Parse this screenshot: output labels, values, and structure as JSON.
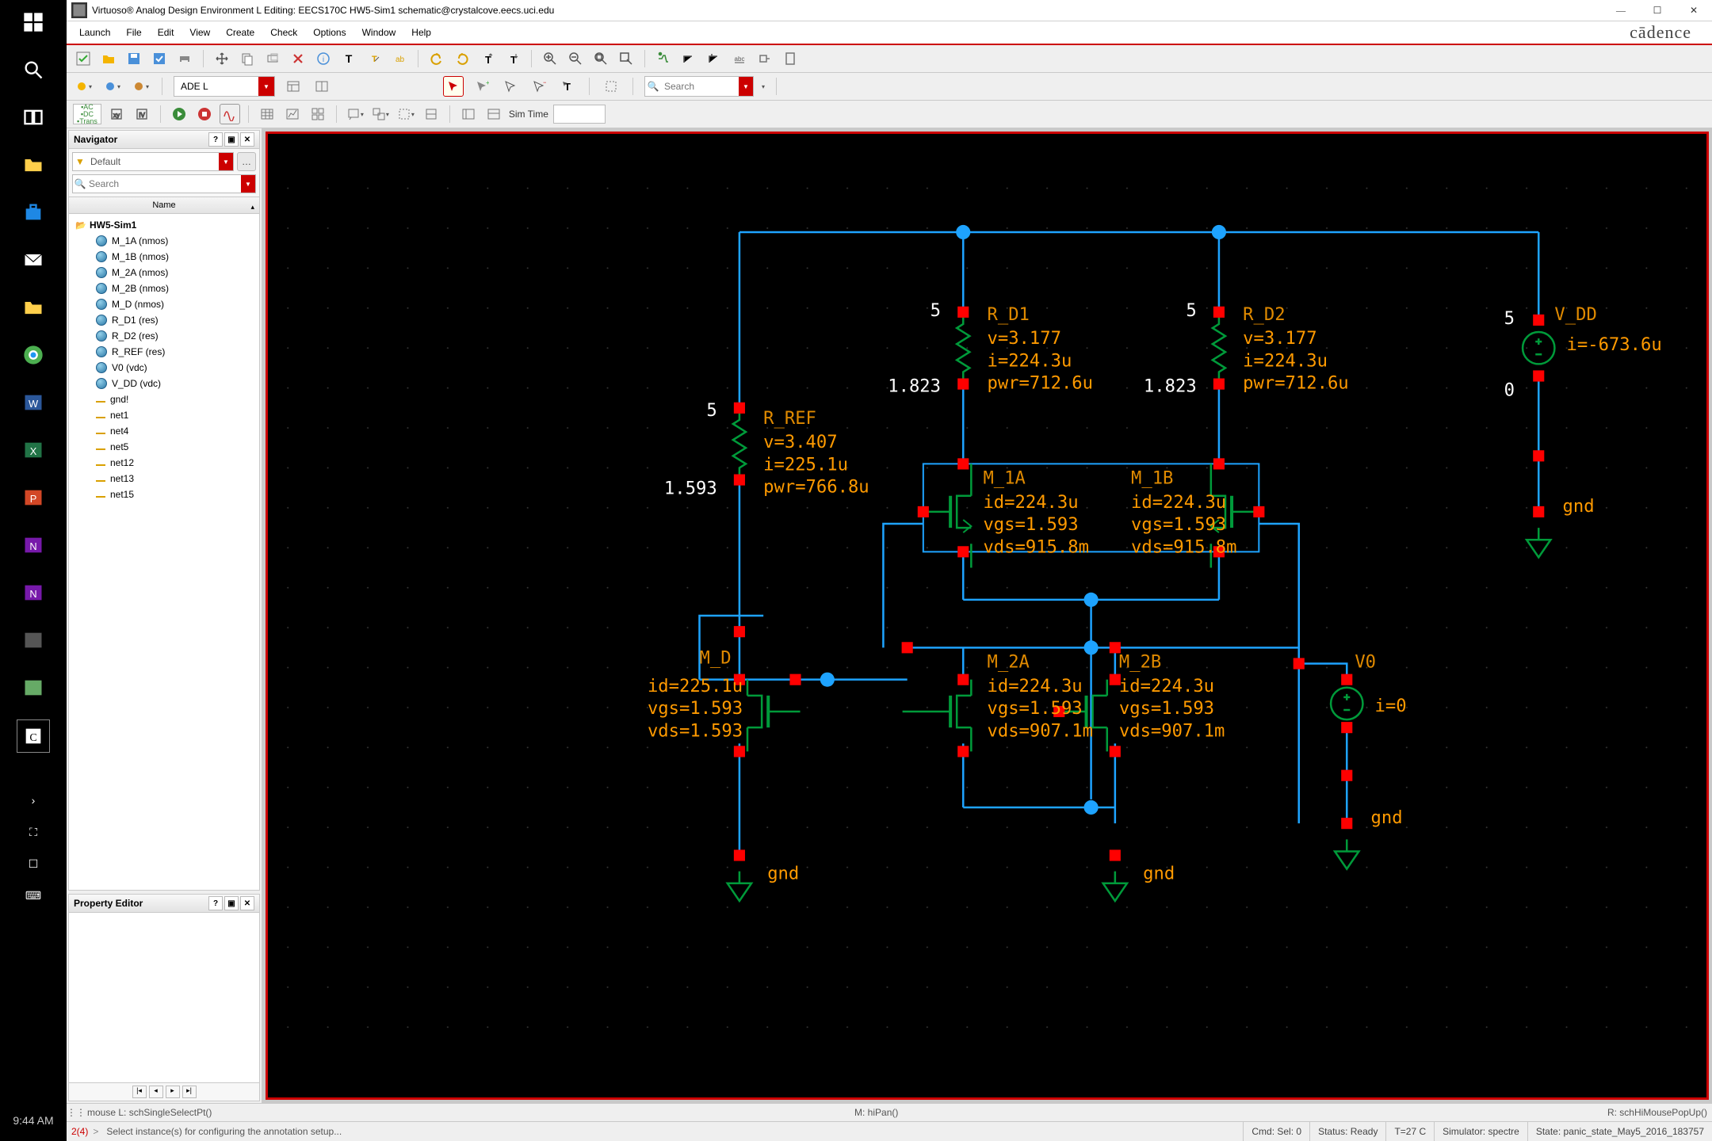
{
  "title": "Virtuoso® Analog Design Environment L Editing: EECS170C HW5-Sim1 schematic@crystalcove.eecs.uci.edu",
  "brand": "cādence",
  "menu": [
    "Launch",
    "File",
    "Edit",
    "View",
    "Create",
    "Check",
    "Options",
    "Window",
    "Help"
  ],
  "combo1_label": "ADE L",
  "search_placeholder": "Search",
  "sim_time_label": "Sim Time",
  "taskbar_clock": "9:44 AM",
  "navigator": {
    "title": "Navigator",
    "filter_label": "Default",
    "search_placeholder": "Search",
    "tree_header": "Name",
    "root": "HW5-Sim1",
    "instances": [
      "M_1A (nmos)",
      "M_1B (nmos)",
      "M_2A (nmos)",
      "M_2B (nmos)",
      "M_D (nmos)",
      "R_D1 (res)",
      "R_D2 (res)",
      "R_REF (res)",
      "V0 (vdc)",
      "V_DD (vdc)"
    ],
    "nets": [
      "gnd!",
      "net1",
      "net4",
      "net5",
      "net12",
      "net13",
      "net15"
    ]
  },
  "prop_editor": {
    "title": "Property Editor"
  },
  "schematic": {
    "R_D1": {
      "name": "R_D1",
      "top": "5",
      "btm": "1.823",
      "v": "v=3.177",
      "i": "i=224.3u",
      "pwr": "pwr=712.6u"
    },
    "R_D2": {
      "name": "R_D2",
      "top": "5",
      "btm": "1.823",
      "v": "v=3.177",
      "i": "i=224.3u",
      "pwr": "pwr=712.6u"
    },
    "V_DD": {
      "name": "V_DD",
      "top": "5",
      "i": "i=-673.6u",
      "zero": "0",
      "gnd": "gnd"
    },
    "R_REF": {
      "name": "R_REF",
      "top": "5",
      "btm": "1.593",
      "v": "v=3.407",
      "i": "i=225.1u",
      "pwr": "pwr=766.8u"
    },
    "M_1A": {
      "name": "M_1A",
      "id": "id=224.3u",
      "vgs": "vgs=1.593",
      "vds": "vds=915.8m"
    },
    "M_1B": {
      "name": "M_1B",
      "id": "id=224.3u",
      "vgs": "vgs=1.593",
      "vds": "vds=915.8m"
    },
    "M_D": {
      "name": "M_D",
      "id": "id=225.1u",
      "vgs": "vgs=1.593",
      "vds": "vds=1.593"
    },
    "M_2A": {
      "name": "M_2A",
      "id": "id=224.3u",
      "vgs": "vgs=1.593",
      "vds": "vds=907.1m"
    },
    "M_2B": {
      "name": "M_2B",
      "id": "id=224.3u",
      "vgs": "vgs=1.593",
      "vds": "vds=907.1m"
    },
    "V0": {
      "name": "V0",
      "i": "i=0",
      "gnd": "gnd"
    },
    "gnd_a": "gnd",
    "gnd_b": "gnd"
  },
  "status": {
    "left": "mouse L: schSingleSelectPt()",
    "mid": "M: hiPan()",
    "right": "R: schHiMousePopUp()"
  },
  "cmd": {
    "badge": "2(4)",
    "prompt_prefix": ">",
    "prompt": "Select instance(s) for configuring the annotation setup...",
    "cells": {
      "cmd": "Cmd: Sel: 0",
      "status": "Status: Ready",
      "temp": "T=27  C",
      "simulator": "Simulator: spectre",
      "state": "State: panic_state_May5_2016_183757"
    }
  }
}
